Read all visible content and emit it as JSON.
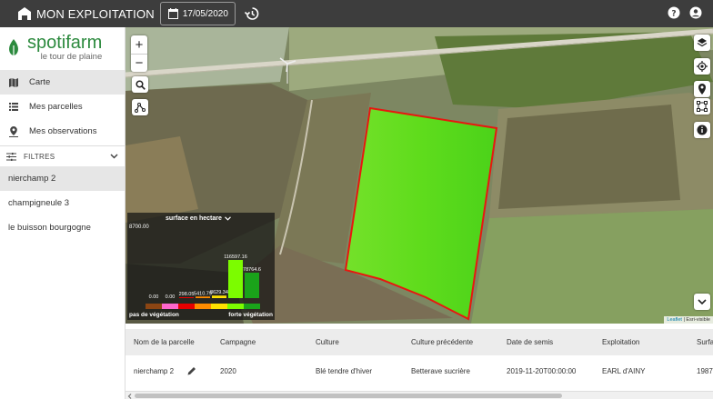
{
  "header": {
    "title": "MON EXPLOITATION",
    "date": "17/05/2020"
  },
  "sidebar": {
    "logo_name": "spotifarm",
    "logo_tagline": "le tour de plaine",
    "nav": [
      {
        "label": "Carte",
        "icon": "map-icon",
        "active": true
      },
      {
        "label": "Mes parcelles",
        "icon": "list-icon",
        "active": false
      },
      {
        "label": "Mes observations",
        "icon": "pin-icon",
        "active": false
      }
    ],
    "filters_label": "FILTRES",
    "farms": [
      {
        "label": "nierchamp 2",
        "active": true
      },
      {
        "label": "champigneule 3",
        "active": false
      },
      {
        "label": "le buisson bourgogne",
        "active": false
      }
    ]
  },
  "map": {
    "zoom_in": "+",
    "zoom_out": "−",
    "attribution_leaflet": "Leaflet",
    "attribution_rest": " | Esri-visible"
  },
  "legend": {
    "title": "surface en hectare",
    "y_max_label": "8700.00",
    "bars": [
      {
        "label": "0.00",
        "value": 0,
        "color": "#8b4513"
      },
      {
        "label": "0.00",
        "value": 0,
        "color": "#ff66cc"
      },
      {
        "label": "298.05",
        "value": 298.05,
        "color": "#e60000"
      },
      {
        "label": "5410.79",
        "value": 5410.79,
        "color": "#ff8c00"
      },
      {
        "label": "8629.34",
        "value": 8629.34,
        "color": "#ffe100"
      },
      {
        "label": "116597.16",
        "value": 116597.16,
        "color": "#7cfc00"
      },
      {
        "label": "78764.6",
        "value": 78764.6,
        "color": "#1aa31a"
      }
    ],
    "left_caption": "pas de végétation",
    "right_caption": "forte végétation"
  },
  "table": {
    "headers": [
      "Nom de la parcelle",
      "Campagne",
      "Culture",
      "Culture précédente",
      "Date de semis",
      "Exploitation",
      "Surfa"
    ],
    "rows": [
      [
        "nierchamp 2",
        "2020",
        "Blé tendre d'hiver",
        "Betterave sucrière",
        "2019-11-20T00:00:00",
        "EARL d'AINY",
        "1987"
      ]
    ]
  }
}
